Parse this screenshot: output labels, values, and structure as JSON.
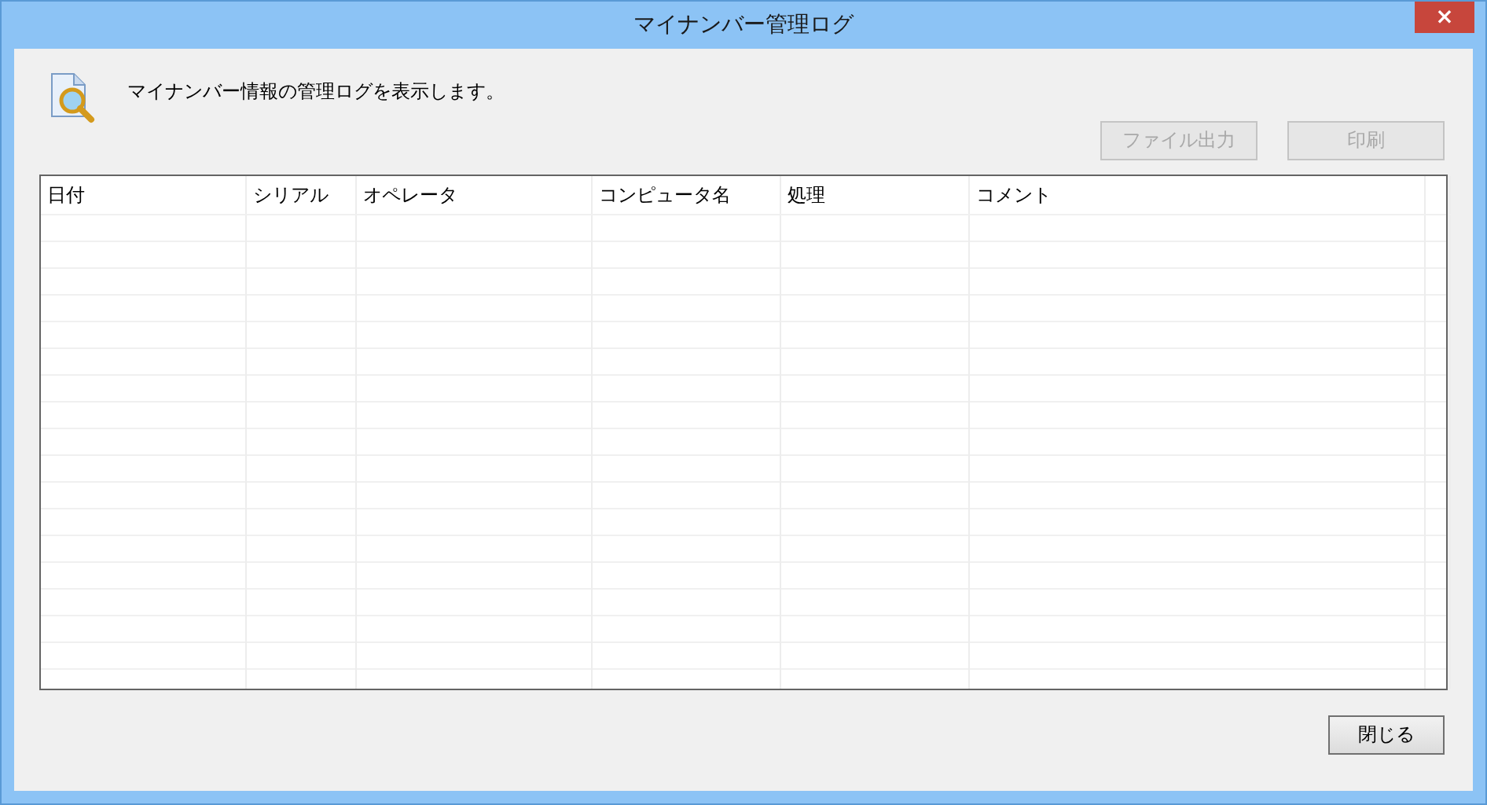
{
  "window": {
    "title": "マイナンバー管理ログ",
    "close": "×"
  },
  "description": "マイナンバー情報の管理ログを表示します。",
  "toolbar_buttons": [
    {
      "label": "ファイル出力",
      "disabled": true
    },
    {
      "label": "印刷",
      "disabled": true
    }
  ],
  "table": {
    "columns": [
      "日付",
      "シリアル",
      "オペレータ",
      "コンピュータ名",
      "処理",
      "コメント"
    ]
  },
  "footer_buttons": [
    {
      "label": "閉じる",
      "disabled": false
    }
  ]
}
